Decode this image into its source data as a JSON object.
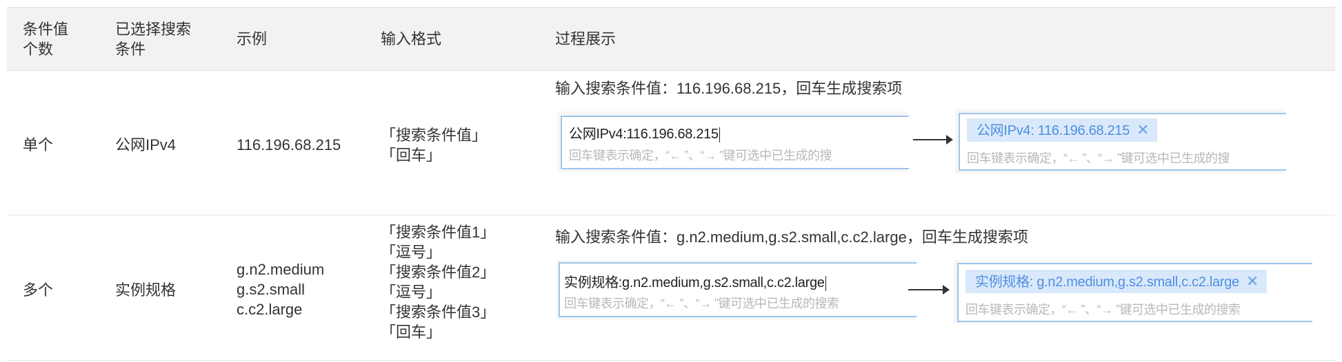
{
  "headers": {
    "count": "条件值\n个数",
    "selected": "已选择搜索\n条件",
    "example": "示例",
    "format": "输入格式",
    "process": "过程展示"
  },
  "rows": [
    {
      "count": "单个",
      "condition": "公网IPv4",
      "example": [
        "116.196.68.215"
      ],
      "format": [
        "「搜索条件值」",
        "「回车」"
      ],
      "desc": "输入搜索条件值：116.196.68.215，回车生成搜索项",
      "input_text": "公网IPv4:116.196.68.215",
      "tag_text": "公网IPv4: 116.196.68.215",
      "hint": "回车键表示确定，“← ”、“→ ”键可选中已生成的搜",
      "hint2": "回车键表示确定，“← ”、“→ ”键可选中已生成的搜"
    },
    {
      "count": "多个",
      "condition": "实例规格",
      "example": [
        "g.n2.medium",
        "g.s2.small",
        "c.c2.large"
      ],
      "format": [
        "「搜索条件值1」",
        "「逗号」",
        "「搜索条件值2」",
        "「逗号」",
        "「搜索条件值3」",
        "「回车」"
      ],
      "desc": "输入搜索条件值：g.n2.medium,g.s2.small,c.c2.large，回车生成搜索项",
      "input_text": "实例规格:g.n2.medium,g.s2.small,c.c2.large",
      "tag_text": "实例规格: g.n2.medium,g.s2.small,c.c2.large",
      "hint": "回车键表示确定，“← ”、“→ ”键可选中已生成的搜索",
      "hint2": "回车键表示确定，“← ”、“→ ”键可选中已生成的搜索"
    }
  ],
  "icons": {
    "close": "close-icon",
    "arrow": "arrow-right-icon"
  },
  "colors": {
    "header_bg": "#f2f2f2",
    "tag_bg": "#d9e9fb",
    "tag_text": "#4f8fe0",
    "field_border": "#9cc5ec"
  }
}
